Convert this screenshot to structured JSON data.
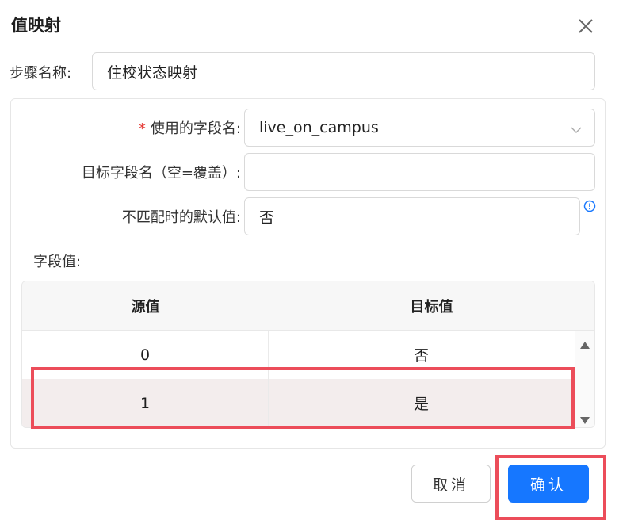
{
  "dialog": {
    "title": "值映射",
    "close_icon": "close-icon"
  },
  "step": {
    "label": "步骤名称:",
    "value": "住校状态映射"
  },
  "fields": {
    "required_mark": "*",
    "source_field_label": "使用的字段名:",
    "source_field_value": "live_on_campus",
    "target_field_label": "目标字段名（空=覆盖）:",
    "target_field_value": "",
    "default_label": "不匹配时的默认值:",
    "default_value": "否",
    "info_icon": "info-icon"
  },
  "values_table": {
    "label": "字段值:",
    "columns": [
      "源值",
      "目标值"
    ],
    "rows": [
      {
        "source": "0",
        "target": "否"
      },
      {
        "source": "1",
        "target": "是"
      }
    ],
    "selected_row_index": 1
  },
  "footer": {
    "cancel_label": "取消",
    "confirm_label": "确认"
  },
  "colors": {
    "primary": "#1677ff",
    "highlight_border": "#ec4d5a",
    "required": "#e53935"
  }
}
